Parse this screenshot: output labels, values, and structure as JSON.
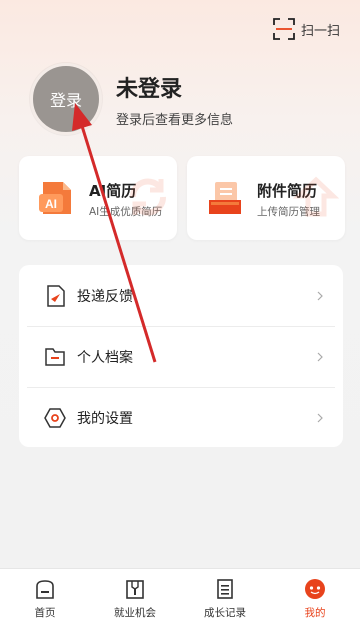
{
  "header": {
    "scan_label": "扫一扫"
  },
  "profile": {
    "avatar_label": "登录",
    "name": "未登录",
    "subtitle": "登录后查看更多信息"
  },
  "cards": [
    {
      "title": "AI简历",
      "subtitle": "AI生成优质简历",
      "icon": "ai-resume-icon"
    },
    {
      "title": "附件简历",
      "subtitle": "上传简历管理",
      "icon": "attachment-resume-icon"
    }
  ],
  "menu": [
    {
      "label": "投递反馈",
      "icon": "send-feedback-icon"
    },
    {
      "label": "个人档案",
      "icon": "folder-icon"
    },
    {
      "label": "我的设置",
      "icon": "settings-hexagon-icon"
    }
  ],
  "tabs": [
    {
      "label": "首页",
      "icon": "home-icon"
    },
    {
      "label": "就业机会",
      "icon": "job-opportunity-icon"
    },
    {
      "label": "成长记录",
      "icon": "growth-record-icon"
    },
    {
      "label": "我的",
      "icon": "me-icon",
      "active": true
    }
  ],
  "colors": {
    "accent": "#e8431c",
    "annotation": "#d42a2a"
  }
}
